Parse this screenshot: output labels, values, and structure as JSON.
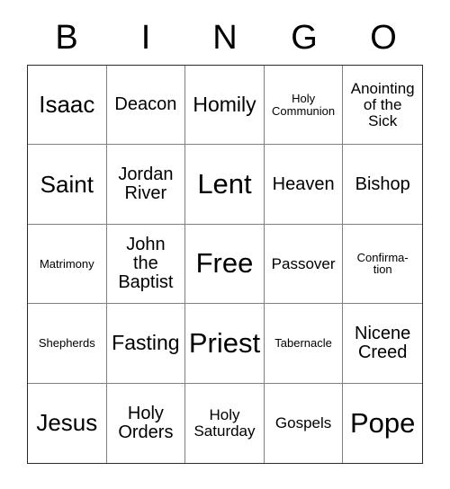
{
  "card": {
    "title": "BINGO",
    "header_letters": [
      "B",
      "I",
      "N",
      "G",
      "O"
    ],
    "grid": {
      "columns": 5,
      "rows": 5,
      "free_space": "Free",
      "border_color": "#2b2b2b",
      "gridline_color": "#808080",
      "background_color": "#ffffff",
      "text_color": "#000000"
    },
    "cells": [
      {
        "text": "Isaac",
        "size": "xl",
        "column": "B",
        "row": 1
      },
      {
        "text": "Deacon",
        "size": "md",
        "column": "I",
        "row": 1
      },
      {
        "text": "Homily",
        "size": "lg",
        "column": "N",
        "row": 1
      },
      {
        "text": "Holy\nCommunion",
        "size": "xs",
        "column": "G",
        "row": 1
      },
      {
        "text": "Anointing\nof the\nSick",
        "size": "sm",
        "column": "O",
        "row": 1
      },
      {
        "text": "Saint",
        "size": "xl",
        "column": "B",
        "row": 2
      },
      {
        "text": "Jordan\nRiver",
        "size": "md",
        "column": "I",
        "row": 2
      },
      {
        "text": "Lent",
        "size": "xxl",
        "column": "N",
        "row": 2
      },
      {
        "text": "Heaven",
        "size": "md",
        "column": "G",
        "row": 2
      },
      {
        "text": "Bishop",
        "size": "md",
        "column": "O",
        "row": 2
      },
      {
        "text": "Matrimony",
        "size": "xs",
        "column": "B",
        "row": 3
      },
      {
        "text": "John\nthe\nBaptist",
        "size": "md",
        "column": "I",
        "row": 3
      },
      {
        "text": "Free",
        "size": "xxl",
        "column": "N",
        "row": 3
      },
      {
        "text": "Passover",
        "size": "sm",
        "column": "G",
        "row": 3
      },
      {
        "text": "Confirma-\ntion",
        "size": "xs",
        "column": "O",
        "row": 3
      },
      {
        "text": "Shepherds",
        "size": "xs",
        "column": "B",
        "row": 4
      },
      {
        "text": "Fasting",
        "size": "lg",
        "column": "I",
        "row": 4
      },
      {
        "text": "Priest",
        "size": "xxl",
        "column": "N",
        "row": 4
      },
      {
        "text": "Tabernacle",
        "size": "xs",
        "column": "G",
        "row": 4
      },
      {
        "text": "Nicene\nCreed",
        "size": "md",
        "column": "O",
        "row": 4
      },
      {
        "text": "Jesus",
        "size": "xl",
        "column": "B",
        "row": 5
      },
      {
        "text": "Holy\nOrders",
        "size": "md",
        "column": "I",
        "row": 5
      },
      {
        "text": "Holy\nSaturday",
        "size": "sm",
        "column": "N",
        "row": 5
      },
      {
        "text": "Gospels",
        "size": "sm",
        "column": "G",
        "row": 5
      },
      {
        "text": "Pope",
        "size": "xxl",
        "column": "O",
        "row": 5
      }
    ]
  }
}
